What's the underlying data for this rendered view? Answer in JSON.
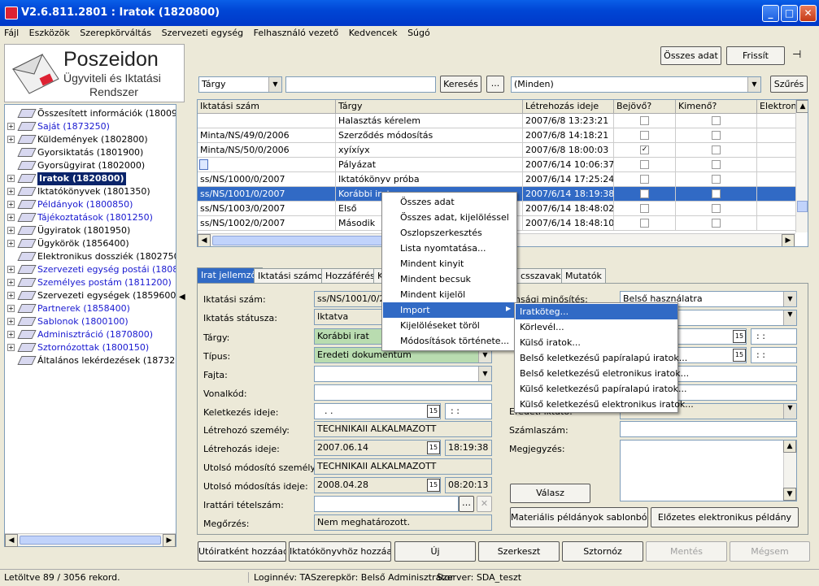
{
  "window": {
    "title": "V2.6.811.2801 : Iratok (1820800)"
  },
  "menu": [
    "Fájl",
    "Eszközök",
    "Szerepkörváltás",
    "Szervezeti egység",
    "Felhasználó vezető",
    "Kedvencek",
    "Súgó"
  ],
  "logo": {
    "name": "Poszeidon",
    "line2": "Ügyviteli és Iktatási",
    "line3": "Rendszer"
  },
  "tree": [
    {
      "label": "Összesített információk (1800950)",
      "blue": false,
      "exp": false
    },
    {
      "label": "Saját (1873250)",
      "blue": true,
      "exp": true
    },
    {
      "label": "Küldemények (1802800)",
      "blue": false,
      "exp": true
    },
    {
      "label": "Gyorsiktatás (1801900)",
      "blue": false,
      "exp": false
    },
    {
      "label": "Gyorsügyirat (1802000)",
      "blue": false,
      "exp": false
    },
    {
      "label": "Iratok (1820800)",
      "blue": false,
      "exp": true,
      "selected": true
    },
    {
      "label": "Iktatókönyvek (1801350)",
      "blue": false,
      "exp": true
    },
    {
      "label": "Példányok (1800850)",
      "blue": true,
      "exp": true
    },
    {
      "label": "Tájékoztatások (1801250)",
      "blue": true,
      "exp": true
    },
    {
      "label": "Ügyiratok (1801950)",
      "blue": false,
      "exp": true
    },
    {
      "label": "Ügykörök (1856400)",
      "blue": false,
      "exp": true
    },
    {
      "label": "Elektronikus dossziék (1802750)",
      "blue": false,
      "exp": false
    },
    {
      "label": "Szervezeti egység postái (1808000)",
      "blue": true,
      "exp": true
    },
    {
      "label": "Személyes postám (1811200)",
      "blue": true,
      "exp": true
    },
    {
      "label": "Szervezeti egységek (1859600)",
      "blue": false,
      "exp": true
    },
    {
      "label": "Partnerek (1858400)",
      "blue": true,
      "exp": true
    },
    {
      "label": "Sablonok (1800100)",
      "blue": true,
      "exp": true
    },
    {
      "label": "Adminisztráció (1870800)",
      "blue": true,
      "exp": true
    },
    {
      "label": "Sztornózottak (1800150)",
      "blue": true,
      "exp": true
    },
    {
      "label": "Általános lekérdezések (1873200)",
      "blue": false,
      "exp": false
    }
  ],
  "toolbar": {
    "osszes_adat": "Összes adat",
    "frissit": "Frissít"
  },
  "search": {
    "field": "Tárgy",
    "value": "",
    "button": "Keresés",
    "ellipsis": "...",
    "filter": "(Minden)",
    "szures": "Szűrés"
  },
  "grid": {
    "columns": [
      "Iktatási szám",
      "Tárgy",
      "Létrehozás ideje",
      "Bejövő?",
      "Kimenő?",
      "Elektroni"
    ],
    "rows": [
      {
        "szam": "",
        "targy": "Halasztás kérelem",
        "ido": "2007/6/8 13:23:21",
        "be": false,
        "ki": false,
        "el": ""
      },
      {
        "szam": "Minta/NS/49/0/2006",
        "targy": "Szerződés módosítás",
        "ido": "2007/6/8 14:18:21",
        "be": false,
        "ki": false,
        "el": ""
      },
      {
        "szam": "Minta/NS/50/0/2006",
        "targy": "xyíxíyx",
        "ido": "2007/6/8 18:00:03",
        "be": true,
        "ki": false,
        "el": ""
      },
      {
        "szam": "",
        "targy": "Pályázat",
        "ido": "2007/6/14 10:06:37",
        "be": false,
        "ki": false,
        "el": "",
        "doc": true
      },
      {
        "szam": "ss/NS/1000/0/2007",
        "targy": "Iktatókönyv próba",
        "ido": "2007/6/14 17:25:24",
        "be": false,
        "ki": false,
        "el": ""
      },
      {
        "szam": "ss/NS/1001/0/2007",
        "targy": "Korábbi irat",
        "ido": "2007/6/14 18:19:38",
        "be": false,
        "ki": false,
        "el": "",
        "hl": true
      },
      {
        "szam": "ss/NS/1003/0/2007",
        "targy": "Első",
        "ido": "2007/6/14 18:48:02",
        "be": false,
        "ki": false,
        "el": ""
      },
      {
        "szam": "ss/NS/1002/0/2007",
        "targy": "Második",
        "ido": "2007/6/14 18:48:10",
        "be": false,
        "ki": false,
        "el": ""
      }
    ]
  },
  "tabs": [
    "Irat jellemzői",
    "Iktatási számok",
    "Hozzáférés",
    "K",
    "csszavak",
    "Mutatók"
  ],
  "form": {
    "iktatasi_szam_l": "Iktatási szám:",
    "iktatasi_szam": "ss/NS/1001/0/2",
    "statusz_l": "Iktatás státusza:",
    "statusz": "Iktatva",
    "targy_l": "Tárgy:",
    "targy": "Korábbi irat",
    "tipus_l": "Típus:",
    "tipus": "Eredeti dokumentum",
    "fajta_l": "Fajta:",
    "fajta": "",
    "vonalkod_l": "Vonalkód:",
    "vonalkod": "",
    "keletkezes_l": "Keletkezés ideje:",
    "keletkezes_d": ". .",
    "keletkezes_t": ":  :",
    "letrehozo_l": "Létrehozó személy:",
    "letrehozo": "TECHNIKAII ALKALMAZOTT",
    "letrehozas_l": "Létrehozás ideje:",
    "letrehozas_d": "2007.06.14",
    "letrehozas_t": "18:19:38",
    "utolso_szem_l": "Utolsó módosító személy:",
    "utolso_szem": "TECHNIKAII ALKALMAZOTT",
    "utolso_ido_l": "Utolsó módosítás ideje:",
    "utolso_d": "2008.04.28",
    "utolso_t": "08:20:13",
    "irattari_l": "Irattári tételszám:",
    "irattari": "",
    "megorzes_l": "Megőrzés:",
    "megorzes": "Nem meghatározott.",
    "bizt_l": "tonsági minősítés:",
    "bizt": "Belső használatra",
    "r_time1": ":  :",
    "r_time2": ":  :",
    "eredeti_l": "Eredeti iktató:",
    "szamlaszam_l": "Számlaszám:",
    "megjegyzes_l": "Megjegyzés:",
    "valasz": "Válasz"
  },
  "bottom_buttons": {
    "materialis": "Materiális példányok sablonból",
    "elozetes": "Előzetes elektronikus példány",
    "utoiratkent": "Utóiratként hozzáad",
    "iktatokonyvhoz": "Iktatókönyvhöz hozzáad",
    "uj": "Új",
    "szerkeszt": "Szerkeszt",
    "sztornoz": "Sztornóz",
    "mentes": "Mentés",
    "megsem": "Mégsem"
  },
  "context_menu": [
    "Összes adat",
    "Összes adat, kijelöléssel",
    "Oszlopszerkesztés",
    "Lista nyomtatása...",
    "Mindent kinyit",
    "Mindent becsuk",
    "Mindent kijelöl",
    "Import",
    "Kijelöléseket töröl",
    "Módosítások története..."
  ],
  "submenu": [
    "Iratköteg...",
    "Körlevél...",
    "Külső iratok...",
    "Belső keletkezésű papíralapú iratok...",
    "Belső keletkezésű eletronikus iratok...",
    "Külső keletkezésű papíralapú iratok...",
    "Külső keletkezésű elektronikus iratok..."
  ],
  "status": {
    "records": "Letöltve 89 / 3056 rekord.",
    "login": "Loginnév: TA",
    "role": "Szerepkör: Belső Adminisztrátor",
    "server": "Szerver: SDA_teszt"
  }
}
